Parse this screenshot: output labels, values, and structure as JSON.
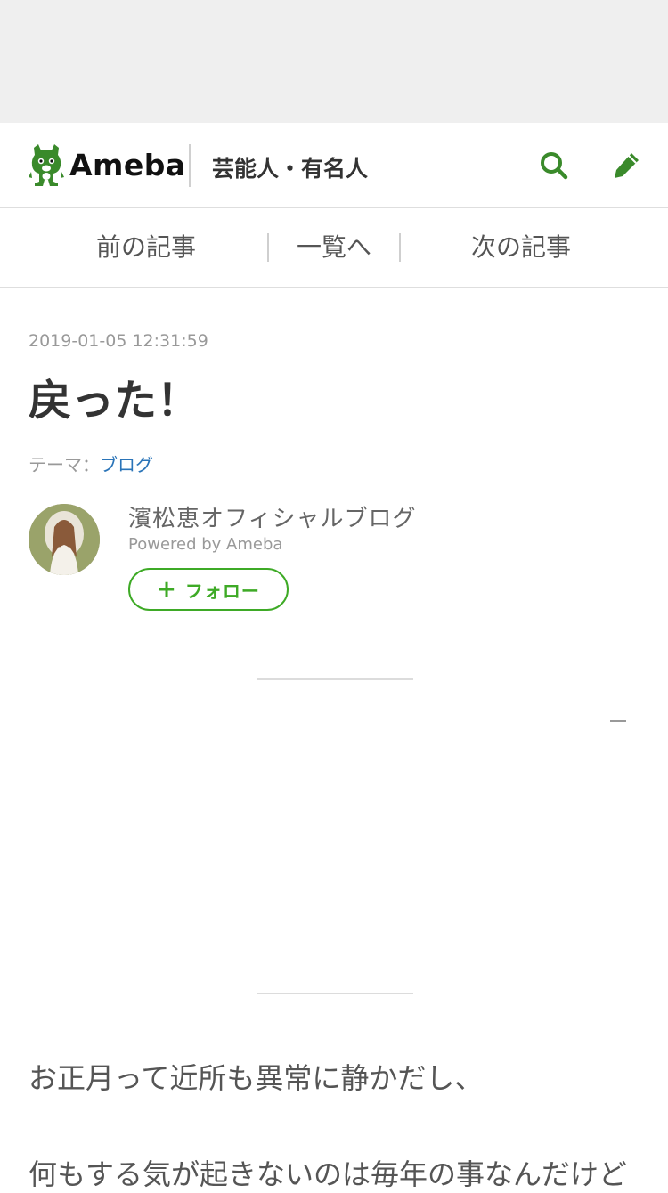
{
  "header": {
    "logo_text": "Ameba",
    "category": "芸能人・有名人",
    "brand_color": "#3a8a2b"
  },
  "pager": {
    "prev_label": "前の記事",
    "list_label": "一覧へ",
    "next_label": "次の記事"
  },
  "article": {
    "date": "2019-01-05 12:31:59",
    "title": "戻った！",
    "theme_label": "テーマ：",
    "theme_value": "ブログ",
    "dash": "–",
    "body_lines": [
      "お正月って近所も異常に静かだし、",
      "何もする気が起きないのは毎年の事なんだけど"
    ]
  },
  "blog": {
    "name": "濱松恵オフィシャルブログ",
    "powered_by": "Powered by Ameba",
    "follow_label": "フォロー"
  },
  "colors": {
    "follow_green": "#3eaa26",
    "link_blue": "#2a74b8"
  }
}
